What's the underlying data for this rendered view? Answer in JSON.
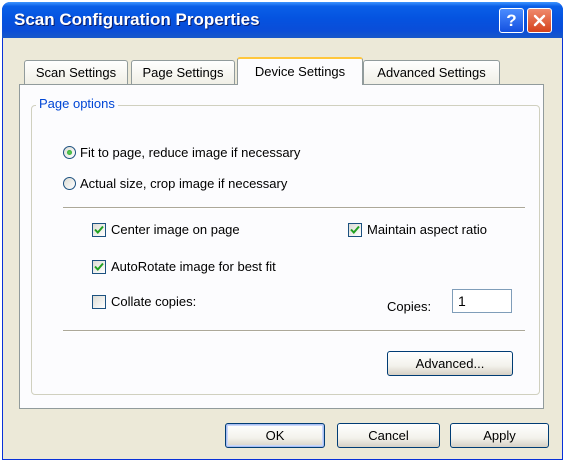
{
  "window": {
    "title": "Scan Configuration Properties",
    "help_glyph": "?",
    "close_icon": "close-icon"
  },
  "tabs": [
    {
      "label": "Scan Settings",
      "active": false
    },
    {
      "label": "Page Settings",
      "active": false
    },
    {
      "label": "Device Settings",
      "active": true
    },
    {
      "label": "Advanced Settings",
      "active": false
    }
  ],
  "page_options": {
    "group_label": "Page options",
    "fit_to_page": {
      "label": "Fit to page, reduce image if necessary",
      "selected": true
    },
    "actual_size": {
      "label": "Actual size, crop image if necessary",
      "selected": false
    },
    "center_image": {
      "label": "Center image on page",
      "checked": true
    },
    "maintain_aspect": {
      "label": "Maintain aspect ratio",
      "checked": true
    },
    "autorotate": {
      "label": "AutoRotate image for best fit",
      "checked": true
    },
    "collate": {
      "label": "Collate copies:",
      "checked": false
    },
    "copies_label": "Copies:",
    "copies_value": "1",
    "advanced_button": "Advanced..."
  },
  "footer": {
    "ok": "OK",
    "cancel": "Cancel",
    "apply": "Apply"
  },
  "colors": {
    "titlebar": "#0553e0",
    "dialog_bg": "#ece9d8",
    "group_label": "#0046d5",
    "check_mark": "#21a121",
    "active_tab_highlight": "#ffc73c"
  }
}
